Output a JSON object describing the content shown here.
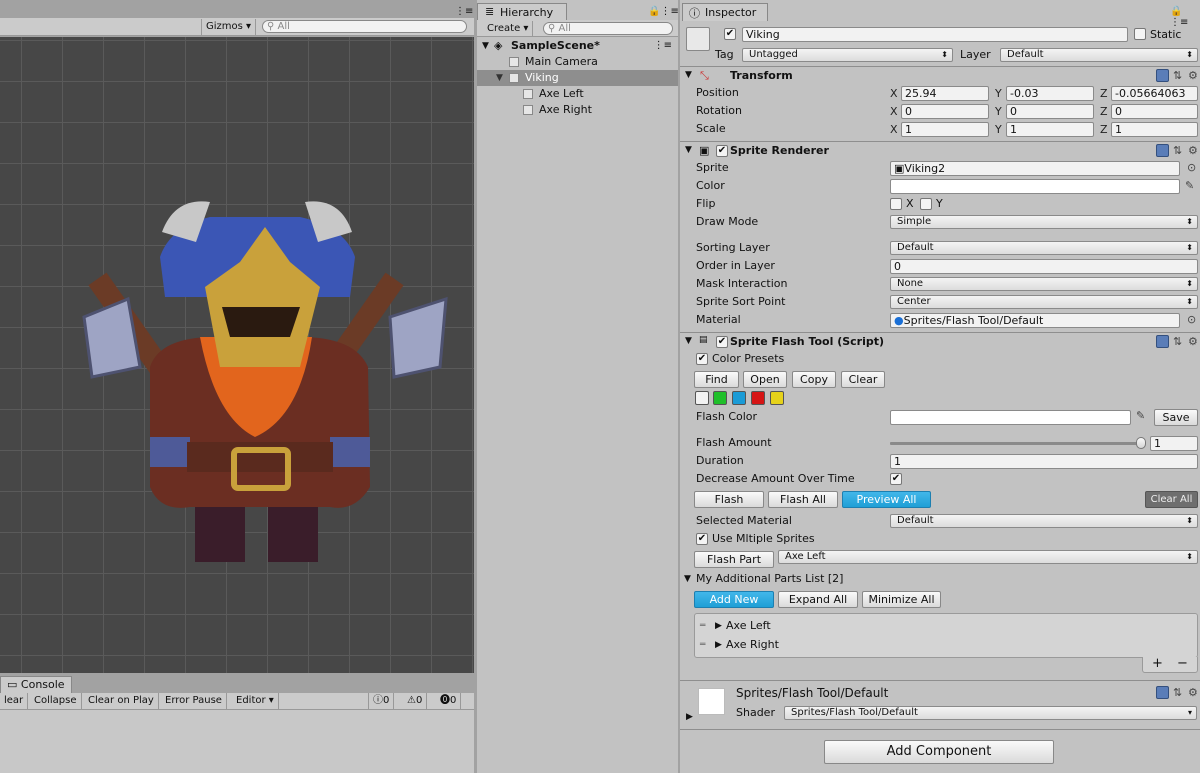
{
  "scene": {
    "gizmos_label": "Gizmos",
    "search_placeholder": "All"
  },
  "console": {
    "tab_label": "Console",
    "toolbar": {
      "clear": "lear",
      "collapse": "Collapse",
      "clear_on_play": "Clear on Play",
      "error_pause": "Error Pause",
      "editor": "Editor"
    },
    "counts": {
      "info": "0",
      "warning": "0",
      "error": "0"
    }
  },
  "hierarchy": {
    "tab_label": "Hierarchy",
    "create_label": "Create",
    "search_placeholder": "All",
    "scene_name": "SampleScene*",
    "items": [
      {
        "label": "Main Camera"
      },
      {
        "label": "Viking"
      },
      {
        "label": "Axe Left"
      },
      {
        "label": "Axe Right"
      }
    ]
  },
  "inspector": {
    "tab_label": "Inspector",
    "object_name": "Viking",
    "static_label": "Static",
    "tag_label": "Tag",
    "tag_value": "Untagged",
    "layer_label": "Layer",
    "layer_value": "Default",
    "transform": {
      "title": "Transform",
      "position_label": "Position",
      "rotation_label": "Rotation",
      "scale_label": "Scale",
      "x": "X",
      "y": "Y",
      "z": "Z",
      "position": {
        "x": "25.94",
        "y": "-0.03",
        "z": "-0.05664063"
      },
      "rotation": {
        "x": "0",
        "y": "0",
        "z": "0"
      },
      "scale": {
        "x": "1",
        "y": "1",
        "z": "1"
      }
    },
    "sprite_renderer": {
      "title": "Sprite Renderer",
      "sprite_label": "Sprite",
      "sprite_value": "Viking2",
      "color_label": "Color",
      "flip_label": "Flip",
      "flip_x": "X",
      "flip_y": "Y",
      "draw_mode_label": "Draw Mode",
      "draw_mode_value": "Simple",
      "sorting_layer_label": "Sorting Layer",
      "sorting_layer_value": "Default",
      "order_label": "Order in Layer",
      "order_value": "0",
      "mask_label": "Mask Interaction",
      "mask_value": "None",
      "sort_point_label": "Sprite Sort Point",
      "sort_point_value": "Center",
      "material_label": "Material",
      "material_value": "Sprites/Flash Tool/Default"
    },
    "flash_tool": {
      "title": "Sprite Flash Tool (Script)",
      "color_presets_label": "Color Presets",
      "buttons": {
        "find": "Find",
        "open": "Open",
        "copy": "Copy",
        "clear": "Clear"
      },
      "preset_colors": [
        "#f2f2f2",
        "#1fbf2a",
        "#1a9bd6",
        "#d61515",
        "#e6d21a"
      ],
      "flash_color_label": "Flash Color",
      "save_label": "Save",
      "flash_amount_label": "Flash Amount",
      "flash_amount_value": "1",
      "flash_amount_fraction": 1,
      "duration_label": "Duration",
      "duration_value": "1",
      "decrease_label": "Decrease Amount Over Time",
      "flash_label": "Flash",
      "flash_all_label": "Flash All",
      "preview_all_label": "Preview All",
      "clear_all_label": "Clear All",
      "selected_material_label": "Selected Material",
      "selected_material_value": "Default",
      "use_multiple_label": "Use Mltiple Sprites",
      "flash_part_label": "Flash Part",
      "flash_part_value": "Axe Left",
      "parts_list_label": "My Additional Parts List [2]",
      "add_new_label": "Add New",
      "expand_all_label": "Expand All",
      "minimize_all_label": "Minimize All",
      "parts": [
        {
          "label": "Axe Left"
        },
        {
          "label": "Axe Right"
        }
      ],
      "plus": "+",
      "minus": "−"
    },
    "material": {
      "name": "Sprites/Flash Tool/Default",
      "shader_label": "Shader",
      "shader_value": "Sprites/Flash Tool/Default"
    },
    "add_component_label": "Add Component"
  }
}
